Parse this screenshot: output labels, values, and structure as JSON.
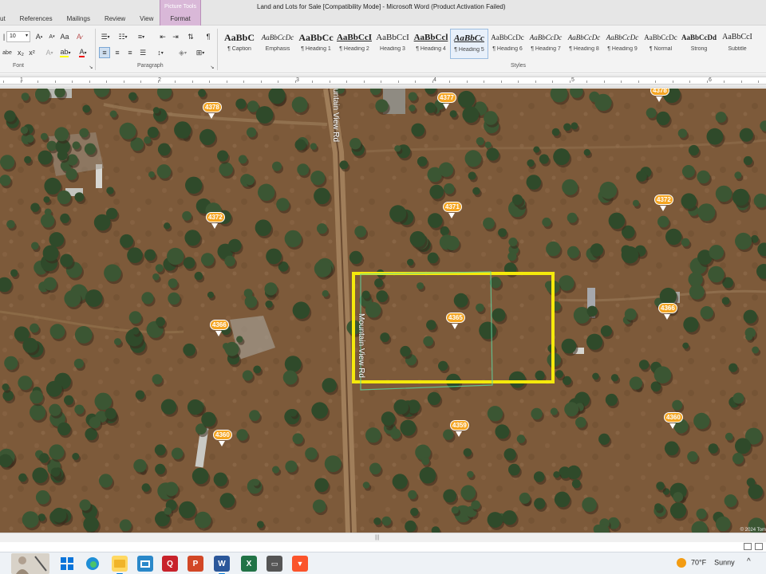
{
  "window": {
    "title": "Land and Lots for Sale [Compatibility Mode]  -  Microsoft Word (Product Activation Failed)"
  },
  "ribbon_tabs": [
    {
      "label": "ut"
    },
    {
      "label": "References"
    },
    {
      "label": "Mailings"
    },
    {
      "label": "Review"
    },
    {
      "label": "View"
    }
  ],
  "context_tab": {
    "group_label": "Picture Tools",
    "tab_label": "Format"
  },
  "font_group": {
    "font_size": "10",
    "label": "Font",
    "grow_label": "A",
    "shrink_label": "A",
    "abc_label": "abe",
    "color_label": "A"
  },
  "paragraph_group": {
    "label": "Paragraph"
  },
  "styles_group": {
    "label": "Styles",
    "items": [
      {
        "sample": "AaBbC",
        "name": "¶ Caption"
      },
      {
        "sample": "AaBbCcDc",
        "name": "Emphasis"
      },
      {
        "sample": "AaBbCc",
        "name": "¶ Heading 1"
      },
      {
        "sample": "AaBbCcI",
        "name": "¶ Heading 2"
      },
      {
        "sample": "AaBbCcI",
        "name": "Heading 3"
      },
      {
        "sample": "AaBbCcl",
        "name": "¶ Heading 4"
      },
      {
        "sample": "AaBbCc",
        "name": "¶ Heading 5"
      },
      {
        "sample": "AaBbCcDc",
        "name": "¶ Heading 6"
      },
      {
        "sample": "AaBbCcDc",
        "name": "¶ Heading 7"
      },
      {
        "sample": "AaBbCcDc",
        "name": "¶ Heading 8"
      },
      {
        "sample": "AaBbCcDc",
        "name": "¶ Heading 9"
      },
      {
        "sample": "AaBbCcDc",
        "name": "¶ Normal"
      },
      {
        "sample": "AaBbCcDd",
        "name": "Strong"
      },
      {
        "sample": "AaBbCcI",
        "name": "Subtitle"
      }
    ]
  },
  "ruler": {
    "numbers": [
      "1",
      "2",
      "3",
      "4",
      "5",
      "6"
    ]
  },
  "map": {
    "road_label_top": "untain View Rd",
    "road_label_bottom": "Mountain View Rd",
    "copyright": "© 2024 Tom",
    "parcels": [
      {
        "label": "4378"
      },
      {
        "label": "4377"
      },
      {
        "label": "4378"
      },
      {
        "label": "4372"
      },
      {
        "label": "4371"
      },
      {
        "label": "4372"
      },
      {
        "label": "4365"
      },
      {
        "label": "4366"
      },
      {
        "label": "4366"
      },
      {
        "label": "4360"
      },
      {
        "label": "4359"
      },
      {
        "label": "4360"
      }
    ],
    "highlight_color": "#f5e90c"
  },
  "taskbar": {
    "apps": [
      {
        "icon": "avatar-icon",
        "label": ""
      },
      {
        "icon": "windows-icon",
        "label": ""
      },
      {
        "icon": "edge-icon",
        "label": ""
      },
      {
        "icon": "chrome-icon",
        "label": ""
      },
      {
        "icon": "folder-icon",
        "label": ""
      },
      {
        "icon": "photo-icon",
        "label": ""
      },
      {
        "icon": "pdf-icon",
        "label": ""
      },
      {
        "icon": "powerpoint-icon",
        "label": "P"
      },
      {
        "icon": "word-icon",
        "label": "W"
      },
      {
        "icon": "excel-icon",
        "label": "X"
      },
      {
        "icon": "car-icon",
        "label": ""
      },
      {
        "icon": "brave-icon",
        "label": ""
      }
    ],
    "weather_temp": "70°F",
    "weather_text": "Sunny"
  }
}
